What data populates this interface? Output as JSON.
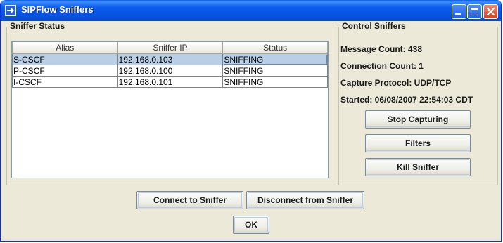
{
  "window": {
    "title": "SIPFlow Sniffers"
  },
  "sniffer_status": {
    "legend": "Sniffer Status",
    "columns": [
      "Alias",
      "Sniffer IP",
      "Status"
    ],
    "rows": [
      {
        "alias": "S-CSCF",
        "ip": "192.168.0.103",
        "status": "SNIFFING",
        "selected": true
      },
      {
        "alias": "P-CSCF",
        "ip": "192.168.0.100",
        "status": "SNIFFING",
        "selected": false
      },
      {
        "alias": "I-CSCF",
        "ip": "192.168.0.101",
        "status": "SNIFFING",
        "selected": false
      }
    ]
  },
  "control": {
    "legend": "Control Sniffers",
    "message_count": "Message Count: 438",
    "connection_count": "Connection Count: 1",
    "capture_protocol": "Capture Protocol: UDP/TCP",
    "started": "Started: 06/08/2007 22:54:03 CDT",
    "stop_label": "Stop Capturing",
    "filters_label": "Filters",
    "kill_label": "Kill Sniffer"
  },
  "footer": {
    "connect_label": "Connect to Sniffer",
    "disconnect_label": "Disconnect from Sniffer",
    "ok_label": "OK"
  },
  "colors": {
    "titlebar": "#0c5ded",
    "window_bg": "#ece9d8",
    "selection": "#b8cfe5",
    "close_button": "#d3401e"
  },
  "icons": {
    "app": "arrow-right-icon",
    "minimize": "minimize-icon",
    "maximize": "maximize-icon",
    "close": "close-icon"
  }
}
